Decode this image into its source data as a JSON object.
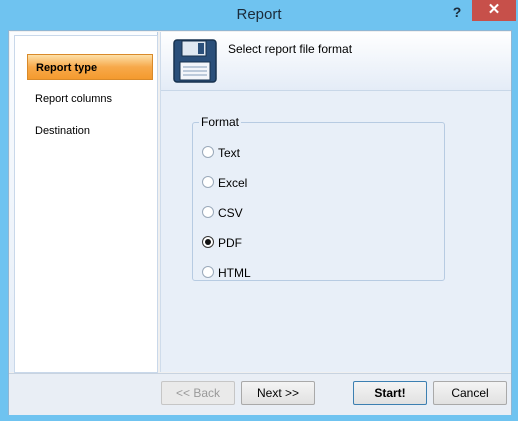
{
  "window": {
    "title": "Report",
    "help": "?",
    "close": "✕"
  },
  "sidebar": {
    "items": [
      {
        "label": "Report type",
        "active": true
      },
      {
        "label": "Report columns",
        "active": false
      },
      {
        "label": "Destination",
        "active": false
      }
    ]
  },
  "header": {
    "text": "Select report file format",
    "icon": "floppy-disk-icon"
  },
  "format": {
    "legend": "Format",
    "options": [
      {
        "label": "Text",
        "checked": false
      },
      {
        "label": "Excel",
        "checked": false
      },
      {
        "label": "CSV",
        "checked": false
      },
      {
        "label": "PDF",
        "checked": true
      },
      {
        "label": "HTML",
        "checked": false
      }
    ]
  },
  "buttons": {
    "back": "<< Back",
    "next": "Next >>",
    "start": "Start!",
    "cancel": "Cancel"
  },
  "colors": {
    "title_bar": "#6fc3f0",
    "active_item": "#f49a2e",
    "close": "#c7504a"
  }
}
